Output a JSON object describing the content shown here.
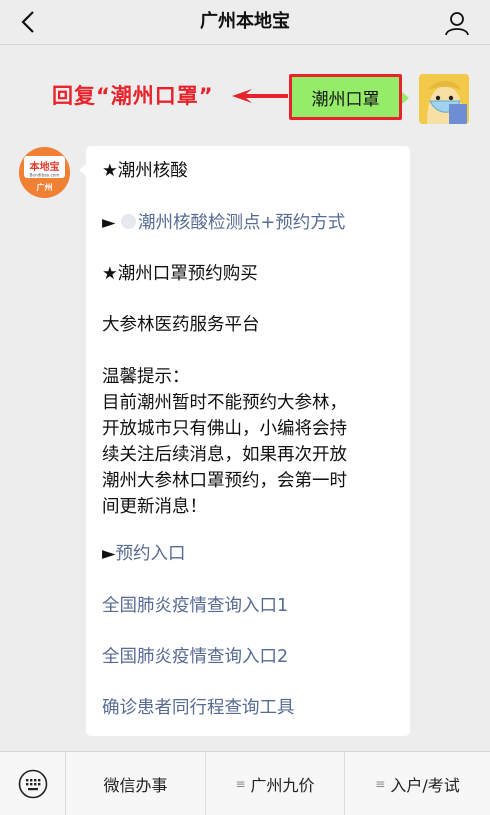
{
  "header": {
    "title": "广州本地宝"
  },
  "annotation": {
    "text": "回复“潮州口罩”",
    "color": "#e8232b"
  },
  "outgoing": {
    "text": "潮州口罩",
    "bubble_color": "#95ec69"
  },
  "bot_avatar": {
    "logo_text": "本地宝",
    "domain": "Bendibao.com",
    "city": "广州"
  },
  "incoming": {
    "line1": "★潮州核酸",
    "link1_prefix": "►",
    "link1": "潮州核酸检测点+预约方式",
    "line2": "★潮州口罩预约购买",
    "line3": "大参林医药服务平台",
    "tips": [
      "温馨提示：",
      "目前潮州暂时不能预约大参林，",
      "开放城市只有佛山，小编将会持",
      "续关注后续消息，如果再次开放",
      "潮州大参林口罩预约，会第一时",
      "间更新消息！"
    ],
    "link2_prefix": "►",
    "link2": "预约入口",
    "link3": "全国肺炎疫情查询入口1",
    "link4": "全国肺炎疫情查询入口2",
    "link5": "确诊患者同行程查询工具"
  },
  "menu": {
    "item1": "微信办事",
    "item2": "广州九价",
    "item3": "入户/考试",
    "mark": "≡"
  }
}
